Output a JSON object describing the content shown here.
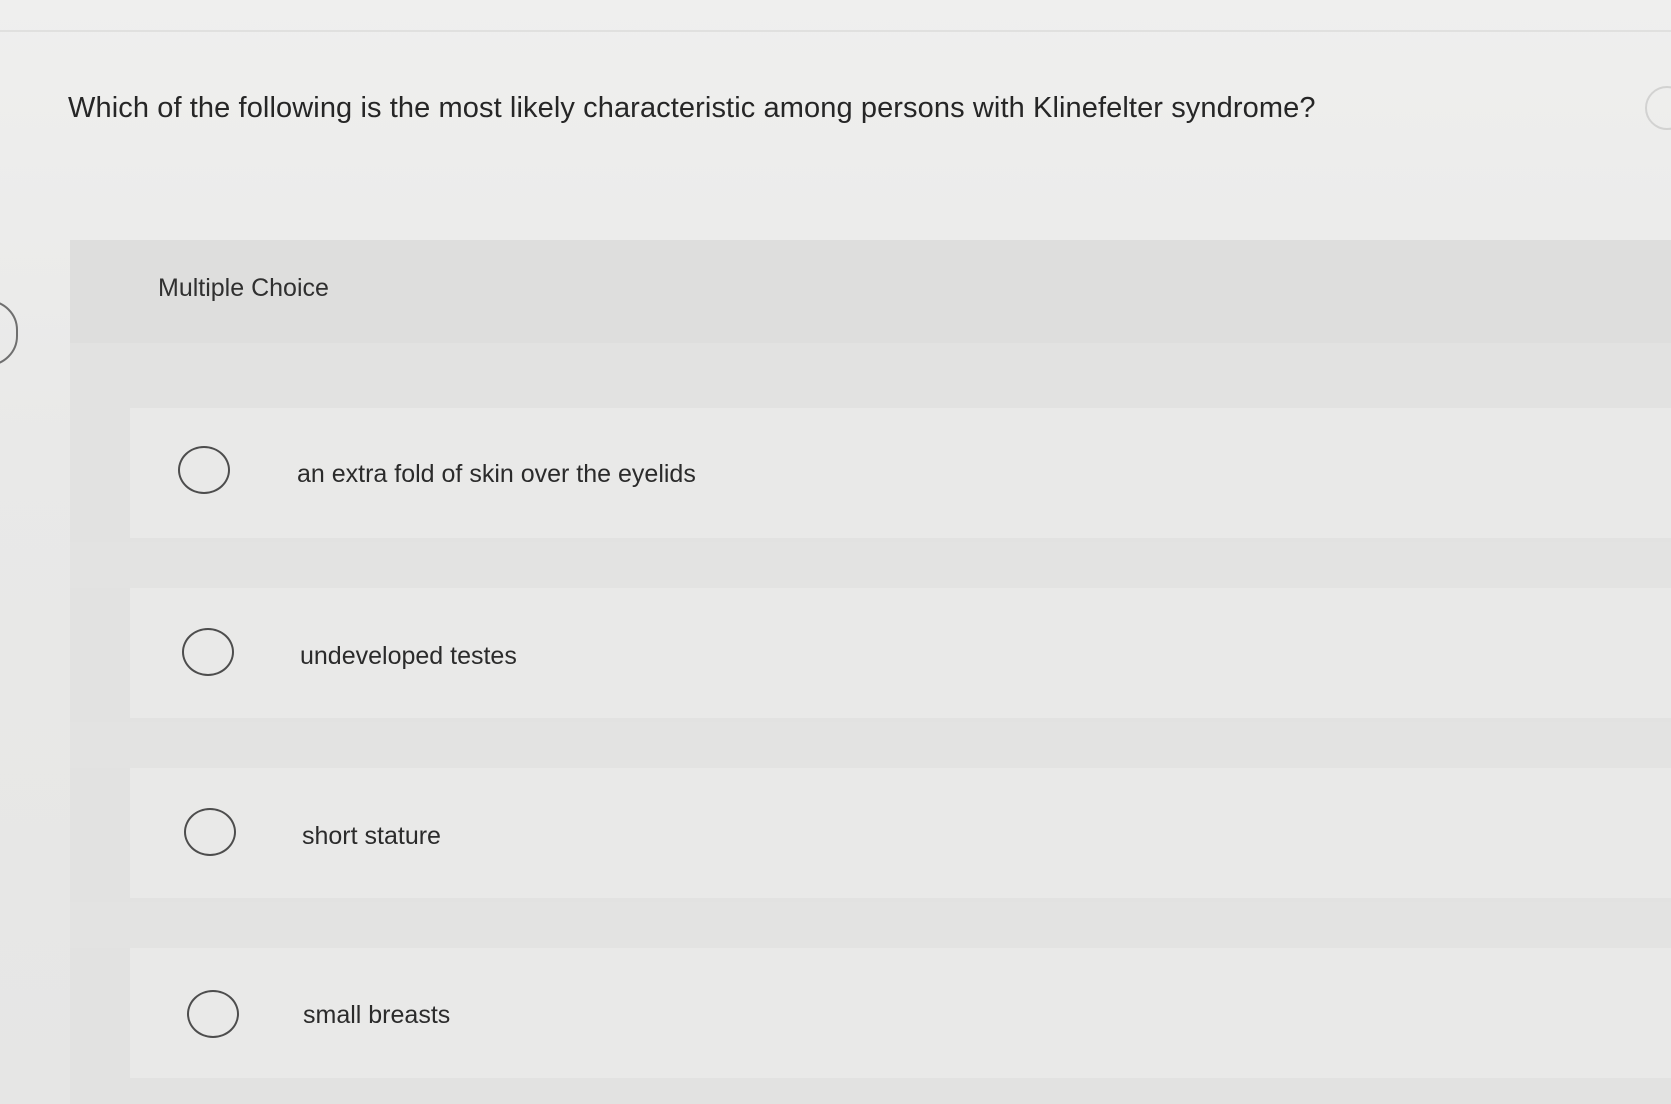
{
  "question": {
    "text": "Which of the following is the most likely characteristic among persons with Klinefelter syndrome?"
  },
  "multiple_choice": {
    "label": "Multiple Choice",
    "options": [
      {
        "label": "an extra fold of skin over the eyelids",
        "selected": false
      },
      {
        "label": "undeveloped testes",
        "selected": false
      },
      {
        "label": "short stature",
        "selected": false
      },
      {
        "label": "small breasts",
        "selected": false
      }
    ]
  }
}
